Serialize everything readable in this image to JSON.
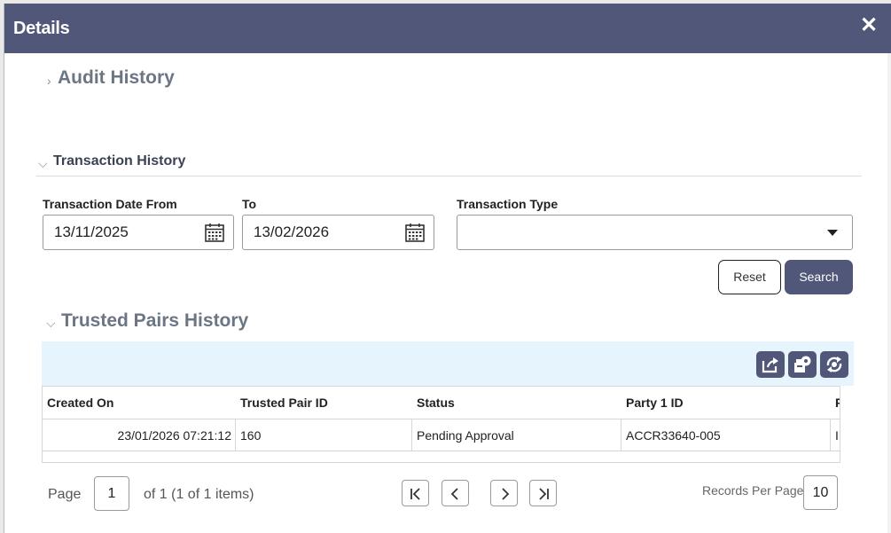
{
  "dialog": {
    "title": "Details"
  },
  "sections": {
    "audit_history": "Audit History",
    "transaction_history": "Transaction History",
    "trusted_pairs_history": "Trusted Pairs History"
  },
  "filters": {
    "date_from_label": "Transaction Date From",
    "date_from_value": "13/11/2025",
    "date_to_label": "To",
    "date_to_value": "13/02/2026",
    "type_label": "Transaction Type",
    "type_value": ""
  },
  "buttons": {
    "reset": "Reset",
    "search": "Search"
  },
  "toolbar": {
    "icons": [
      "export-icon",
      "settings-icon",
      "refresh-icon"
    ]
  },
  "table": {
    "columns": [
      "Created On",
      "Trusted Pair ID",
      "Status",
      "Party 1 ID",
      "P"
    ],
    "rows": [
      [
        "23/01/2026 07:21:12",
        "160",
        "Pending Approval",
        "ACCR33640-005",
        "I"
      ]
    ]
  },
  "pager": {
    "page_label": "Page",
    "page_value": "1",
    "of_text": "of 1 (1 of 1 items)",
    "records_per_page_label": "Records Per Page",
    "records_per_page_value": "10"
  },
  "colors": {
    "header": "#505778",
    "toolbar_bg": "#e6f4fd"
  }
}
